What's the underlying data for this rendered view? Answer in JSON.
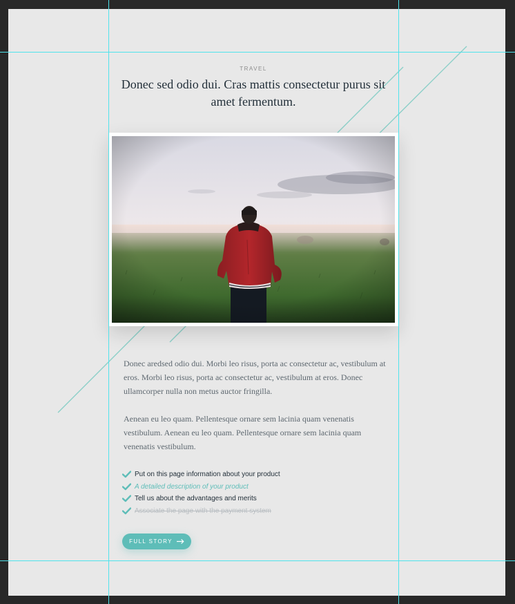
{
  "article": {
    "category": "TRAVEL",
    "headline": "Donec sed odio dui. Cras mattis consectetur purus sit amet fermentum.",
    "photo_alt": "Man in red jacket standing in a misty field",
    "paragraphs": [
      "Donec aredsed odio dui. Morbi leo risus, porta ac consectetur ac, vestibulum at eros. Morbi leo risus, porta ac consectetur ac, vestibulum at eros. Donec ullamcorper nulla non metus auctor fringilla.",
      "Aenean eu leo quam. Pellentesque ornare sem lacinia quam venenatis vestibulum. Aenean eu leo quam. Pellentesque ornare sem lacinia quam venenatis vestibulum."
    ],
    "checklist": [
      {
        "text": "Put on this page information about your product",
        "style": "normal"
      },
      {
        "text": "A detailed description of your product",
        "style": "italic"
      },
      {
        "text": "Tell us about the advantages and merits",
        "style": "bold"
      },
      {
        "text": "Associate the page with the payment system",
        "style": "strikethrough"
      }
    ],
    "cta_label": "FULL STORY"
  },
  "icons": {
    "check": "check-icon",
    "arrow": "arrow-right-icon"
  },
  "colors": {
    "accent": "#5ebdb8",
    "guides": "#4fe3ec",
    "canvas": "#e8e8e8",
    "workspace": "#282828",
    "headline": "#23303a",
    "body": "#5e6870"
  }
}
